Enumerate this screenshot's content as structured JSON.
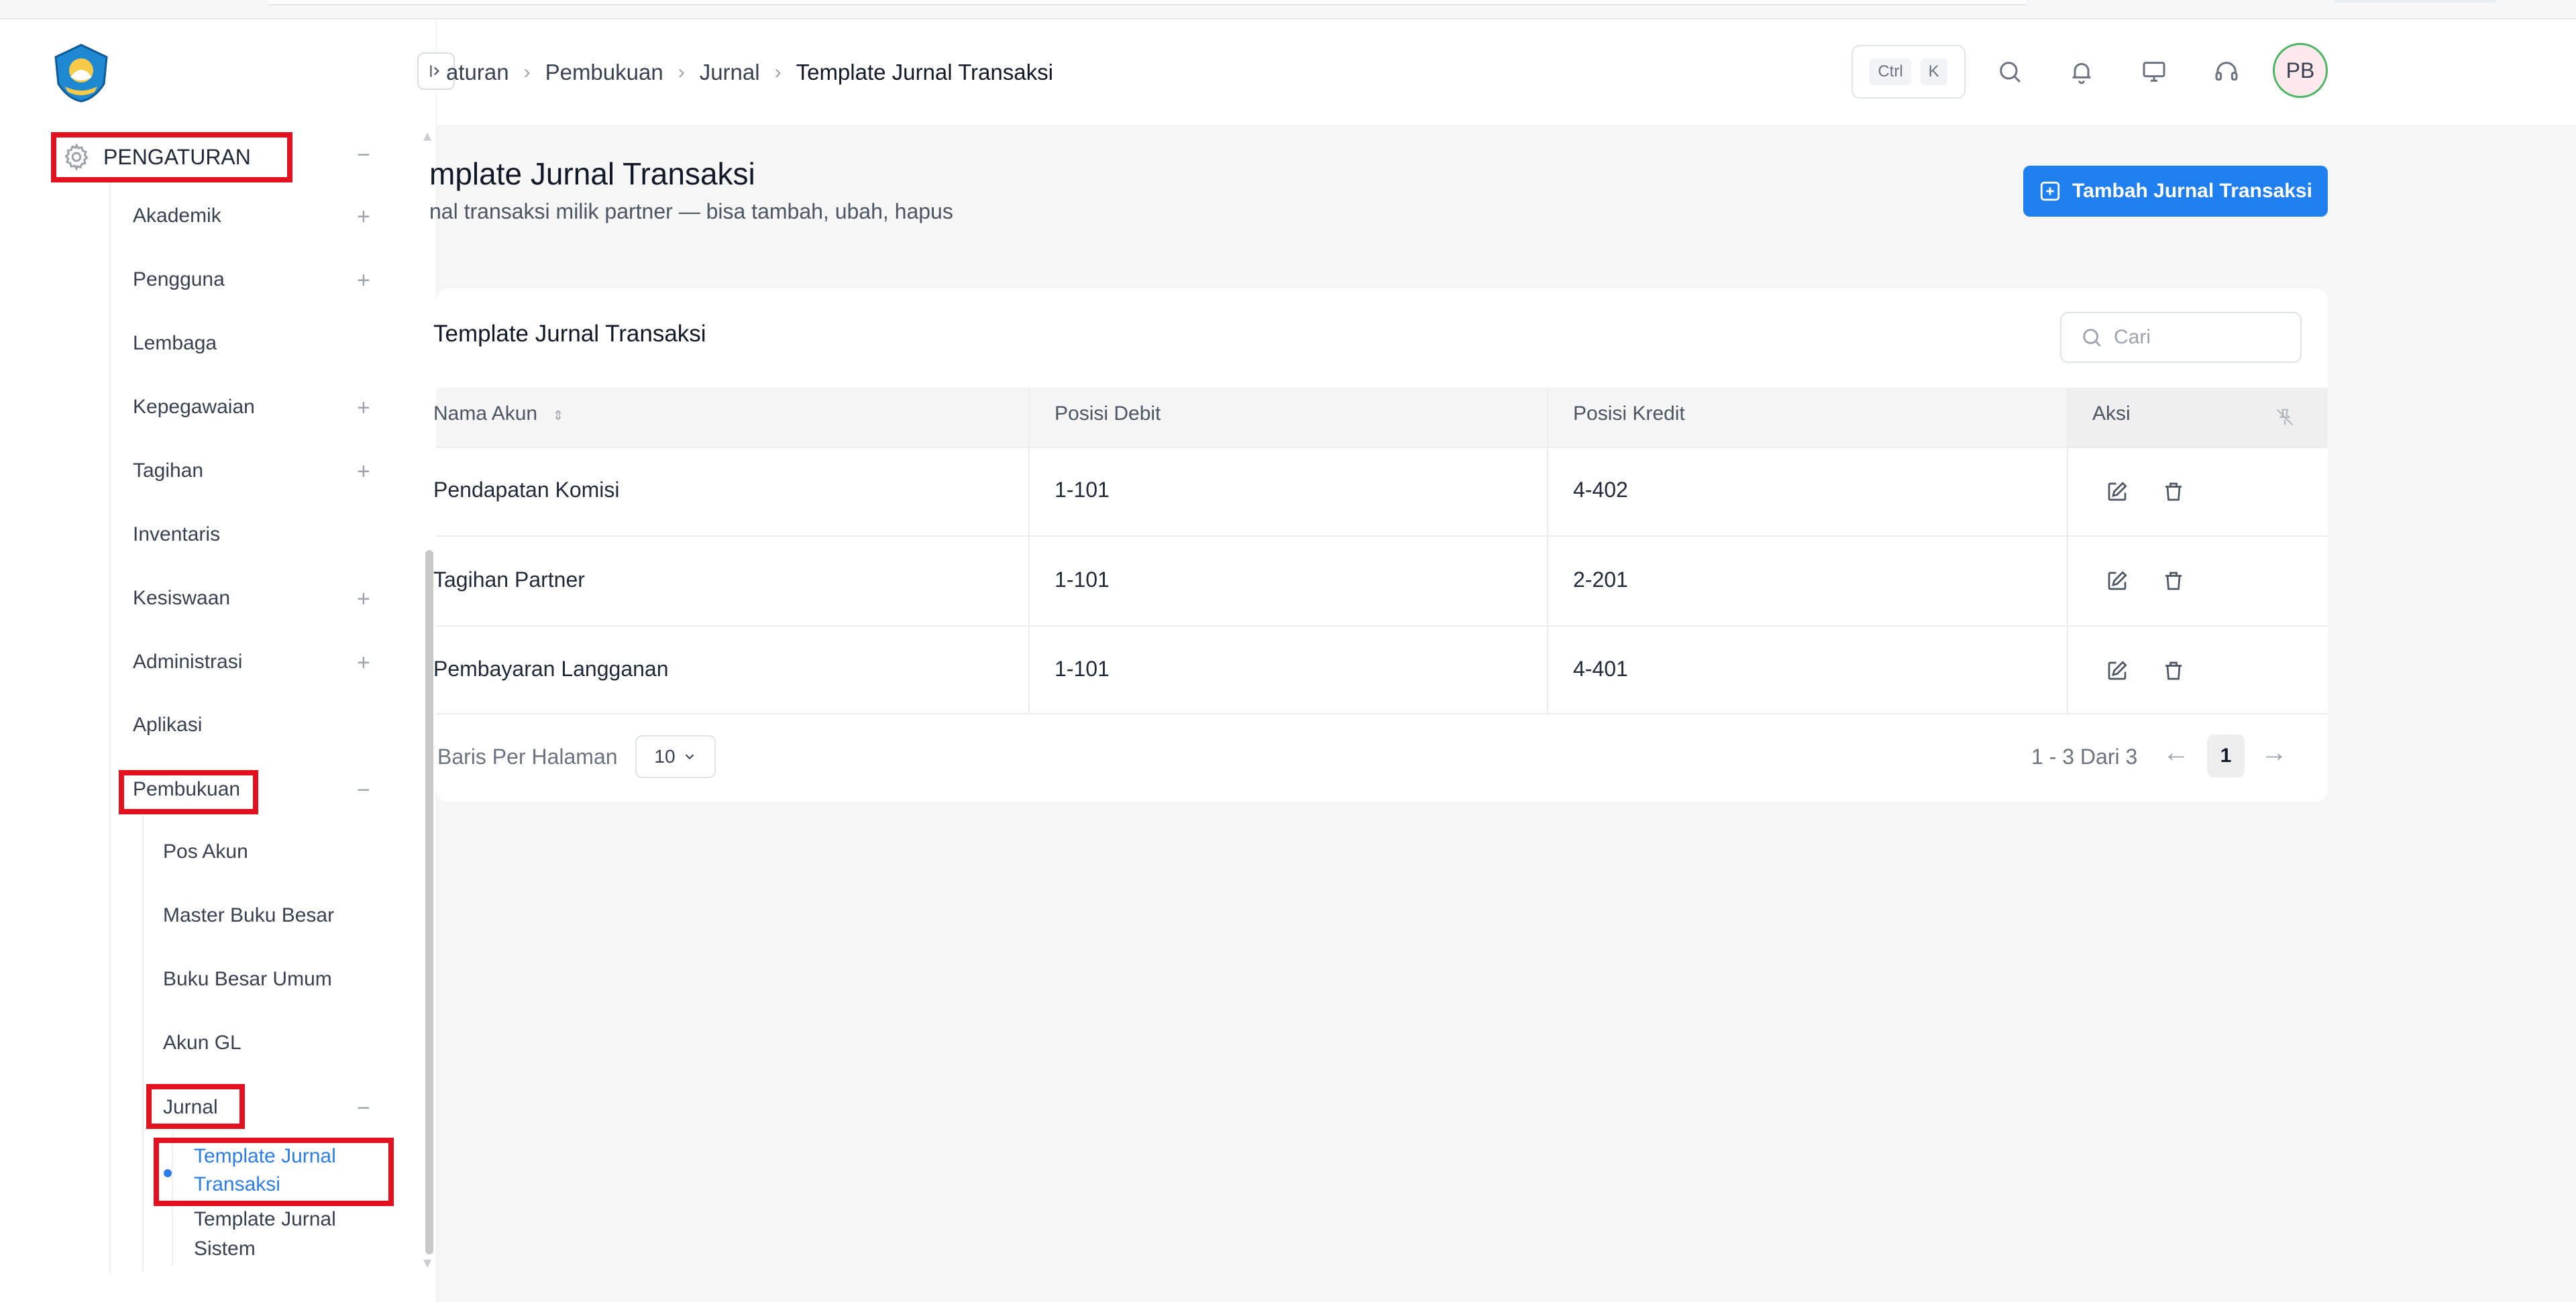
{
  "sidebar": {
    "items": [
      {
        "label": "PENGATURAN",
        "sign": "−"
      },
      {
        "label": "Akademik",
        "sign": "+"
      },
      {
        "label": "Pengguna",
        "sign": "+"
      },
      {
        "label": "Lembaga",
        "sign": ""
      },
      {
        "label": "Kepegawaian",
        "sign": "+"
      },
      {
        "label": "Tagihan",
        "sign": "+"
      },
      {
        "label": "Inventaris",
        "sign": ""
      },
      {
        "label": "Kesiswaan",
        "sign": "+"
      },
      {
        "label": "Administrasi",
        "sign": "+"
      },
      {
        "label": "Aplikasi",
        "sign": ""
      },
      {
        "label": "Pembukuan",
        "sign": "−"
      },
      {
        "label": "Pos Akun",
        "sign": ""
      },
      {
        "label": "Master Buku Besar",
        "sign": ""
      },
      {
        "label": "Buku Besar Umum",
        "sign": ""
      },
      {
        "label": "Akun GL",
        "sign": ""
      },
      {
        "label": "Jurnal",
        "sign": "−"
      },
      {
        "label": "Template Jurnal Transaksi",
        "sign": ""
      },
      {
        "label": "Template Jurnal Sistem",
        "sign": ""
      }
    ]
  },
  "header": {
    "breadcrumb": [
      "aturan",
      "Pembukuan",
      "Jurnal",
      "Template Jurnal Transaksi"
    ],
    "shortcut_keys": [
      "Ctrl",
      "K"
    ],
    "avatar_initials": "PB",
    "icons": [
      "search-icon",
      "bell-icon",
      "monitor-icon",
      "headset-icon"
    ]
  },
  "page": {
    "title": "mplate Jurnal Transaksi",
    "subtitle": "nal transaksi milik partner — bisa tambah, ubah, hapus",
    "add_button_label": "Tambah Jurnal Transaksi"
  },
  "table": {
    "title": "Template Jurnal Transaksi",
    "search_placeholder": "Cari",
    "columns": [
      "Nama Akun",
      "Posisi Debit",
      "Posisi Kredit",
      "Aksi"
    ],
    "rows": [
      {
        "nama_akun": "Pendapatan Komisi",
        "debit": "1-101",
        "kredit": "4-402"
      },
      {
        "nama_akun": "Tagihan Partner",
        "debit": "1-101",
        "kredit": "2-201"
      },
      {
        "nama_akun": "Pembayaran Langganan",
        "debit": "1-101",
        "kredit": "4-401"
      }
    ],
    "rows_per_page_label": "Baris Per Halaman",
    "rows_per_page_value": "10",
    "range_text": "1 - 3 Dari 3",
    "current_page": "1"
  },
  "colors": {
    "accent": "#1f7fee",
    "highlight_box": "#e3101f",
    "active_link": "#2b7de9"
  }
}
